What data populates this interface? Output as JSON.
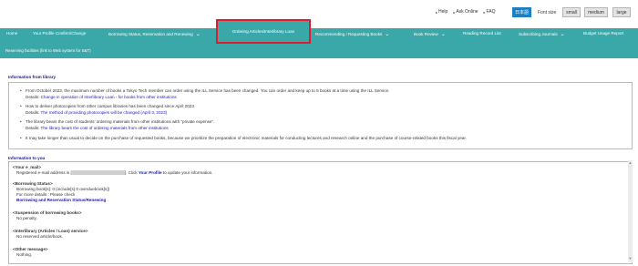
{
  "topbar": {
    "links": [
      "Help",
      "Ask Online",
      "FAQ"
    ],
    "lang_button": "日本語",
    "font_size_label": "Font size",
    "font_sizes": [
      "small",
      "medium",
      "large"
    ]
  },
  "nav": {
    "items": [
      {
        "label": "Home",
        "chevron": false
      },
      {
        "label": "Your Profile Confirm/Change",
        "chevron": false
      },
      {
        "label": "Borrowing Status, Reservation and Renewing",
        "chevron": true
      },
      {
        "label": "Ordering Articles/Interlibrary Loan",
        "chevron": false
      },
      {
        "label": "Recommending / Requesting Books",
        "chevron": true
      },
      {
        "label": "Book Review",
        "chevron": true
      },
      {
        "label": "Reading Record List",
        "chevron": false
      },
      {
        "label": "Subscribing Journals",
        "chevron": true
      },
      {
        "label": "Budget Usage Report",
        "chevron": false
      }
    ],
    "second_row": "Reserving facilities  (link to Web system for S&T)"
  },
  "library_info": {
    "title": "Information from library",
    "bullets": [
      {
        "text": "From October 2023, the maximum number of books a Tokyo Tech member can order using the ILL Service has been changed. You can order and keep up to 5 books at a time using the ILL Service.",
        "details_prefix": "Details: ",
        "details_link": "Change in operation of Interlibrary Loan - for books from other institutions"
      },
      {
        "text": "How to deliver photocopies from other campus libraries has been changed since April 2023.",
        "details_prefix": "Details: ",
        "details_link": "The method of providing photocopies will be changed (April 3, 2023)"
      },
      {
        "text": "The library bears the cost of students' ordering materials from other institutions with \"private expense\".",
        "details_prefix": "Details: ",
        "details_link": "The library bears the cost of ordering materials from other institutions"
      },
      {
        "text": "It may take longer than usual to decide on the purchase of requested books, because we prioritize the preparation of electronic materials for conducting lectures and research online and the purchase of course-related books this fiscal year.",
        "details_prefix": "",
        "details_link": ""
      }
    ]
  },
  "to_you": {
    "title": "Information to you",
    "email_heading": "<Your e_mail>",
    "email_prefix": "Registered e-mail address is [",
    "email_suffix": "]. Click ",
    "email_link": "Your Profile",
    "email_tail": " to update your information.",
    "borrowing_heading": "<Borrowing Status>",
    "borrowing_line": "Borrowing book[s]: 0 (include[s] 0 overduebook[s])",
    "borrowing_details": "For more details : Please check",
    "borrowing_link": "Borrowing and Reservation Status/Renewing",
    "borrowing_link_tail": " .",
    "suspension_heading": "<Suspension of borrowing books>",
    "suspension_value": "No penalty.",
    "ill_heading": "<Interlibrary (Articles / Loan) service>",
    "ill_value": "No reserved article/book.",
    "other_heading": "<Other message>",
    "other_value": "Nothing."
  }
}
